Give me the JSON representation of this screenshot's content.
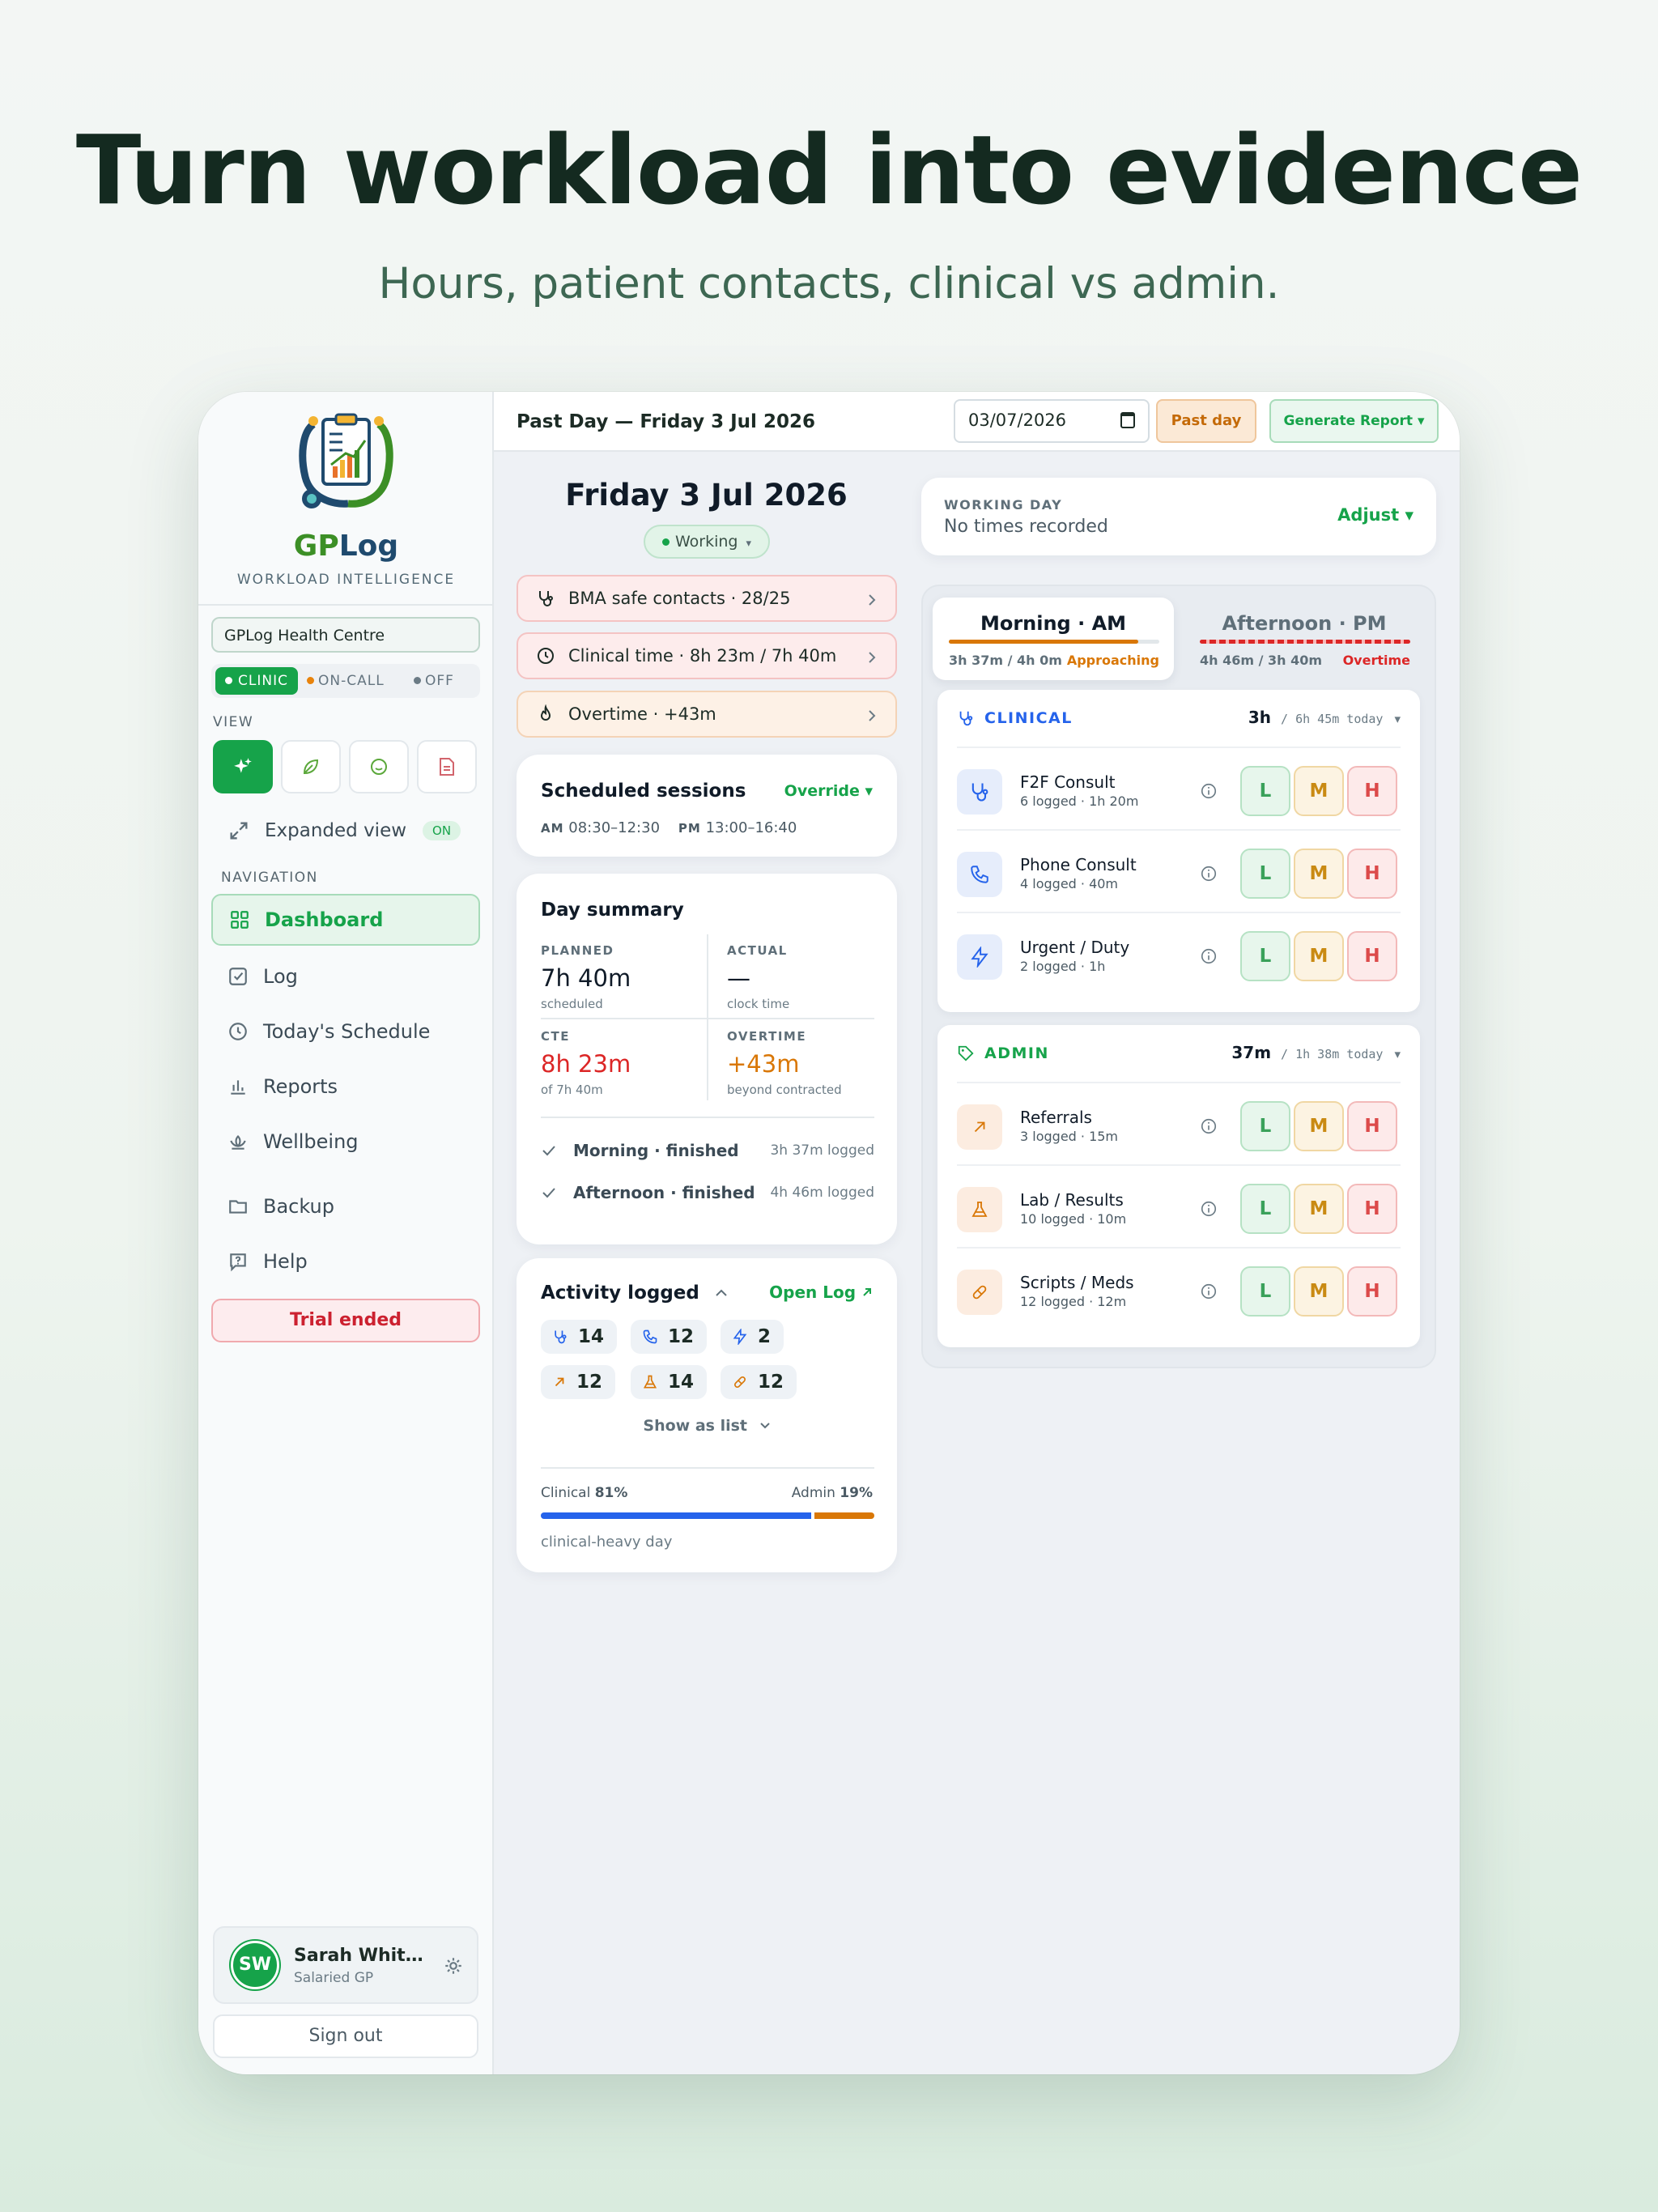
{
  "hero": {
    "title": "Turn workload into evidence",
    "subtitle": "Hours, patient contacts, clinical vs admin."
  },
  "brand": {
    "name_part1": "GP",
    "name_part2": "Log",
    "tagline": "WORKLOAD INTELLIGENCE",
    "practice": "GPLog Health Centre"
  },
  "modes": {
    "clinic": "CLINIC",
    "oncall": "ON-CALL",
    "off": "OFF"
  },
  "sidebar": {
    "view_label": "VIEW",
    "expanded": {
      "label": "Expanded view",
      "badge": "ON"
    },
    "nav_label": "NAVIGATION",
    "items": [
      {
        "label": "Dashboard"
      },
      {
        "label": "Log"
      },
      {
        "label": "Today's Schedule"
      },
      {
        "label": "Reports"
      },
      {
        "label": "Wellbeing"
      },
      {
        "label": "Backup"
      },
      {
        "label": "Help"
      }
    ],
    "trial": "Trial ended"
  },
  "user": {
    "initials": "SW",
    "name": "Sarah Whitfi...",
    "role": "Salaried GP",
    "signout": "Sign out"
  },
  "topbar": {
    "title": "Past Day — Friday 3 Jul 2026",
    "date_value": "03/07/2026",
    "past_day": "Past day",
    "generate": "Generate Report ▾"
  },
  "day": {
    "heading": "Friday 3 Jul 2026",
    "status": "Working"
  },
  "alerts": [
    {
      "text": "BMA safe contacts · 28/25"
    },
    {
      "text": "Clinical time · 8h 23m / 7h 40m"
    },
    {
      "text": "Overtime · +43m"
    }
  ],
  "sessions": {
    "title": "Scheduled sessions",
    "override": "Override ▾",
    "am_label": "AM",
    "am": "08:30–12:30",
    "pm_label": "PM",
    "pm": "13:00–16:40"
  },
  "summary": {
    "title": "Day summary",
    "planned": {
      "k": "PLANNED",
      "v": "7h 40m",
      "s": "scheduled"
    },
    "actual": {
      "k": "ACTUAL",
      "v": "—",
      "s": "clock time"
    },
    "cte": {
      "k": "CTE",
      "v": "8h 23m",
      "s": "of 7h 40m"
    },
    "overtime": {
      "k": "OVERTIME",
      "v": "+43m",
      "s": "beyond contracted"
    },
    "morning": {
      "label": "Morning · finished",
      "logged": "3h 37m logged"
    },
    "afternoon": {
      "label": "Afternoon · finished",
      "logged": "4h 46m logged"
    }
  },
  "activity": {
    "title": "Activity logged",
    "open_log": "Open Log",
    "counts": [
      "14",
      "12",
      "2",
      "12",
      "14",
      "12"
    ],
    "show_list": "Show as list",
    "clinical_label": "Clinical",
    "clinical_pct": "81%",
    "admin_label": "Admin",
    "admin_pct": "19%",
    "clinical_fraction": 0.81,
    "note": "clinical-heavy day"
  },
  "working_day": {
    "label": "WORKING DAY",
    "value": "No times recorded",
    "adjust": "Adjust ▾"
  },
  "tabs": {
    "am": {
      "title": "Morning · AM",
      "meta": "3h 37m / 4h 0m",
      "status": "Approaching",
      "progress": 0.9
    },
    "pm": {
      "title": "Afternoon · PM",
      "meta": "4h 46m / 3h 40m",
      "status": "Overtime",
      "progress": 1.0
    }
  },
  "clinical": {
    "title": "CLINICAL",
    "total": "3h",
    "today": "/ 6h 45m today",
    "rows": [
      {
        "name": "F2F Consult",
        "sub": "6 logged · 1h 20m"
      },
      {
        "name": "Phone Consult",
        "sub": "4 logged · 40m"
      },
      {
        "name": "Urgent / Duty",
        "sub": "2 logged · 1h"
      }
    ]
  },
  "admin": {
    "title": "ADMIN",
    "total": "37m",
    "today": "/ 1h 38m today",
    "rows": [
      {
        "name": "Referrals",
        "sub": "3 logged · 15m"
      },
      {
        "name": "Lab / Results",
        "sub": "10 logged · 10m"
      },
      {
        "name": "Scripts / Meds",
        "sub": "12 logged · 12m"
      }
    ]
  },
  "lmh": {
    "l": "L",
    "m": "M",
    "h": "H"
  },
  "colors": {
    "accent": "#16a34a",
    "clinical": "#2563eb",
    "admin": "#d97706",
    "danger": "#dc2626"
  }
}
